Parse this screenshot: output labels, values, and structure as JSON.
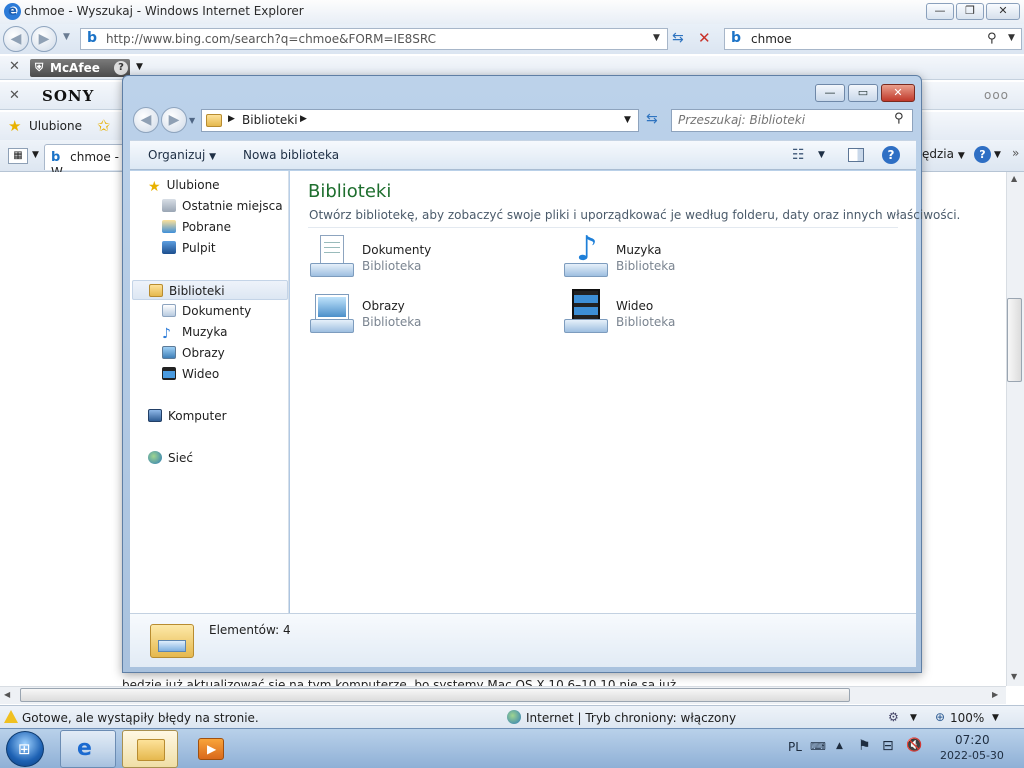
{
  "ie": {
    "title": "chmoe - Wyszukaj - Windows Internet Explorer",
    "address": "http://www.bing.com/search?q=chmoe&FORM=IE8SRC",
    "search_value": "chmoe",
    "mcafee_label": "McAfee",
    "sony_label": "SONY",
    "favorites_label": "Ulubione",
    "tab_label": "chmoe - W",
    "tools_label": "ędzia",
    "page_text": "będzie już aktualizować się na tym komputerze, bo systemy Mac OS X 10.6–10.10 nie są już",
    "status_text": "Gotowe, ale wystąpiły błędy na stronie.",
    "zone_text": "Internet | Tryb chroniony: włączony",
    "zoom": "100%"
  },
  "explorer": {
    "breadcrumb": "Biblioteki",
    "search_placeholder": "Przeszukaj: Biblioteki",
    "cmd": {
      "organize": "Organizuj",
      "new_library": "Nowa biblioteka"
    },
    "nav": {
      "favorites": "Ulubione",
      "recent": "Ostatnie miejsca",
      "downloads": "Pobrane",
      "desktop": "Pulpit",
      "libraries": "Biblioteki",
      "documents": "Dokumenty",
      "music": "Muzyka",
      "pictures": "Obrazy",
      "videos": "Wideo",
      "computer": "Komputer",
      "network": "Sieć"
    },
    "content": {
      "heading": "Biblioteki",
      "subtitle": "Otwórz bibliotekę, aby zobaczyć swoje pliki i uporządkować je według folderu, daty oraz innych właściwości.",
      "items": [
        {
          "name": "Dokumenty",
          "type": "Biblioteka"
        },
        {
          "name": "Muzyka",
          "type": "Biblioteka"
        },
        {
          "name": "Obrazy",
          "type": "Biblioteka"
        },
        {
          "name": "Wideo",
          "type": "Biblioteka"
        }
      ]
    },
    "details": {
      "count": "Elementów: 4"
    }
  },
  "taskbar": {
    "lang": "PL",
    "time": "07:20",
    "date": "2022-05-30"
  },
  "colors": {
    "heading_green": "#1e6e2e",
    "titlebar_blue": "#bcd2ea",
    "close_red": "#c0392b"
  }
}
